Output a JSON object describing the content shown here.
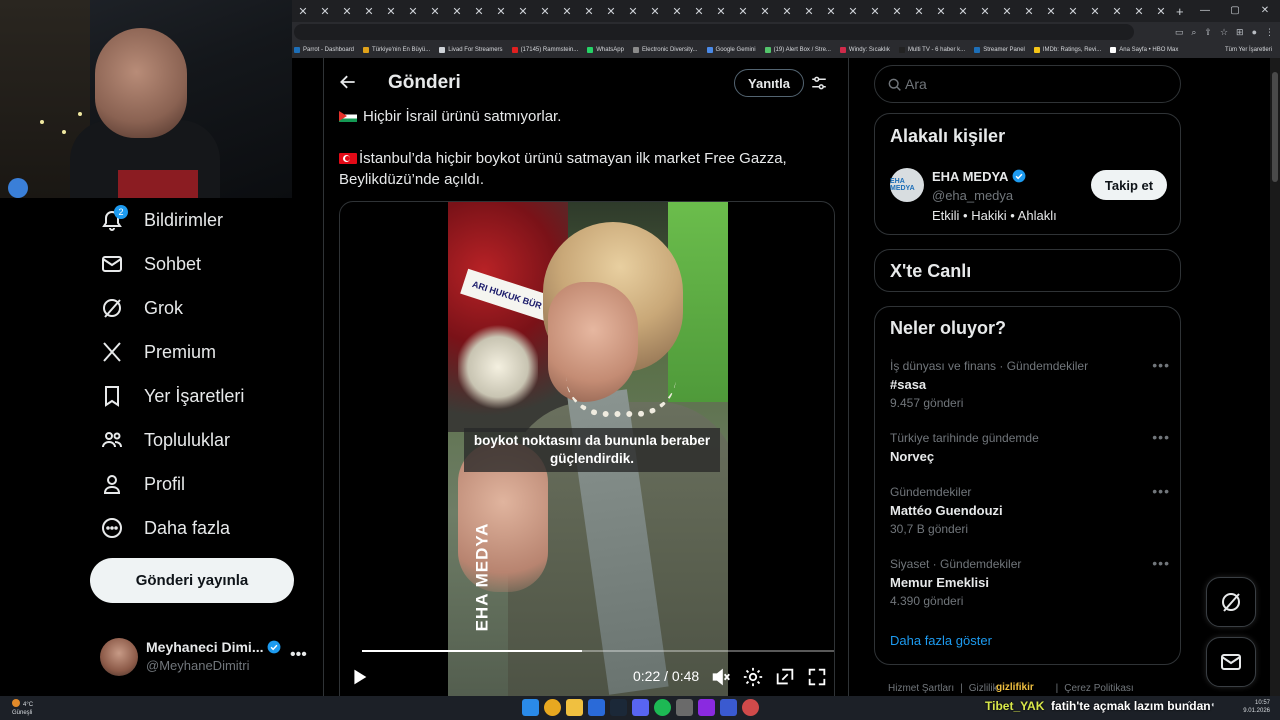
{
  "browser": {
    "tab_count": 40,
    "bookmarks": [
      {
        "label": "Parrot - Dashboard",
        "color": "#1d6fb8"
      },
      {
        "label": "Türkiye'nin En Büyü...",
        "color": "#e0a21a"
      },
      {
        "label": "Livad For Streamers",
        "color": "#cfd3d8"
      },
      {
        "label": "(17145) Rammstein...",
        "color": "#e02020"
      },
      {
        "label": "WhatsApp",
        "color": "#25d366"
      },
      {
        "label": "Electronic Diversity...",
        "color": "#8a8a8a"
      },
      {
        "label": "Google Gemini",
        "color": "#4a8ae8"
      },
      {
        "label": "(19) Alert Box / Stre...",
        "color": "#53c46b"
      },
      {
        "label": "Windy: Sıcaklık",
        "color": "#d02a4a"
      },
      {
        "label": "Multi TV - 6 haber k...",
        "color": "#222222"
      },
      {
        "label": "Streamer Panel",
        "color": "#1d6fb8"
      },
      {
        "label": "IMDb: Ratings, Revi...",
        "color": "#f5c518"
      },
      {
        "label": "Ana Sayfa • HBO Max",
        "color": "#ffffff"
      }
    ],
    "all_bookmarks_label": "Tüm Yer İşaretleri"
  },
  "nav": {
    "items": [
      {
        "label": "Bildirimler",
        "icon": "bell-icon",
        "badge": "2"
      },
      {
        "label": "Sohbet",
        "icon": "envelope-icon"
      },
      {
        "label": "Grok",
        "icon": "grok-icon"
      },
      {
        "label": "Premium",
        "icon": "x-logo-icon"
      },
      {
        "label": "Yer İşaretleri",
        "icon": "bookmark-icon"
      },
      {
        "label": "Topluluklar",
        "icon": "people-icon"
      },
      {
        "label": "Profil",
        "icon": "person-icon"
      },
      {
        "label": "Daha fazla",
        "icon": "more-circle-icon"
      }
    ],
    "post_button": "Gönderi yayınla",
    "account": {
      "name": "Meyhaneci Dimi...",
      "handle": "@MeyhaneDimitri"
    }
  },
  "post": {
    "header_title": "Gönderi",
    "reply_button": "Yanıtla",
    "text_line1": "Hiçbir İsrail ürünü satmıyorlar.",
    "text_line2": "İstanbul’da hiçbir boykot ürünü satmayan ilk market Free Gazza,",
    "text_line3": "Beylikdüzü’nde açıldı.",
    "video": {
      "subtitle": "boykot noktasını da bununla beraber güçlendirdik.",
      "watermark": "EHA MEDYA",
      "banner": "ARI HUKUK BÜR",
      "current_time": "0:22",
      "duration": "0:48",
      "time_display": "0:22 / 0:48",
      "progress": 0.458
    }
  },
  "right": {
    "search_placeholder": "Ara",
    "related_title": "Alakalı kişiler",
    "person": {
      "name": "EHA MEDYA",
      "handle": "@eha_medya",
      "bio": "Etkili • Hakiki • Ahlaklı",
      "avatar_text": "EHA MEDYA",
      "follow_label": "Takip et"
    },
    "live_title": "X'te Canlı",
    "trends_title": "Neler oluyor?",
    "trends": [
      {
        "context": "İş dünyası ve finans · Gündemdekiler",
        "name": "#sasa",
        "count": "9.457 gönderi"
      },
      {
        "context": "Türkiye tarihinde gündemde",
        "name": "Norveç",
        "count": ""
      },
      {
        "context": "Gündemdekiler",
        "name": "Mattéo Guendouzi",
        "count": "30,7 B gönderi"
      },
      {
        "context": "Siyaset · Gündemdekiler",
        "name": "Memur Emeklisi",
        "count": "4.390 gönderi"
      }
    ],
    "show_more": "Daha fazla göster",
    "footer": {
      "terms": "Hizmet Şartları",
      "privacy": "Gizlilik",
      "cookies": "Çerez Politikası"
    }
  },
  "taskbar": {
    "weather_temp": "4°C",
    "weather_desc": "Güneşli",
    "chat_user": "Tibet_YAK",
    "chat_message": "fatih'te açmak lazım bundan",
    "overlay_name": "gizlifikir",
    "time": "10:57",
    "date": "9.01.2026"
  }
}
